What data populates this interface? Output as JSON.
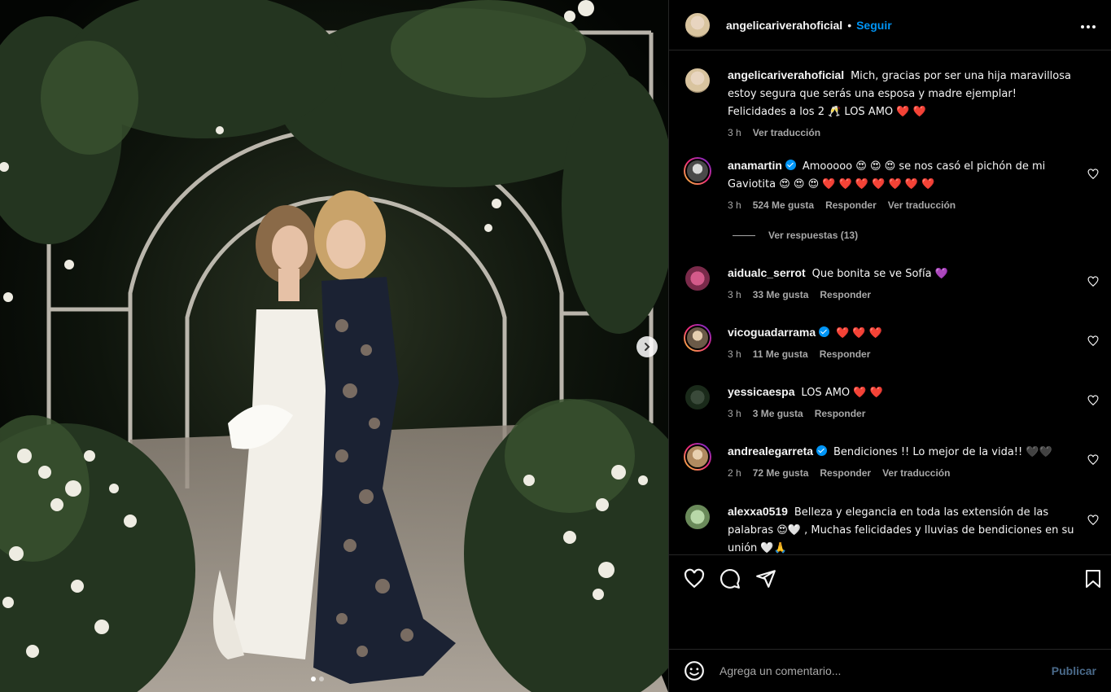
{
  "post": {
    "author": "angelicariverahoficial",
    "separator": "•",
    "follow_label": "Seguir",
    "more_label": "•••",
    "carousel_next": "›"
  },
  "caption": {
    "username": "angelicariverahoficial",
    "text": "Mich, gracias por ser una hija maravillosa estoy segura que serás una esposa y madre ejemplar! Felicidades a los 2 🥂 LOS AMO ❤️ ❤️",
    "time": "3 h",
    "translate": "Ver traducción"
  },
  "comments": [
    {
      "username": "anamartin",
      "verified": true,
      "text": "Amooooo 😍 😍 😍 se nos casó el pichón de mi Gaviotita 😍 😍 😍 ❤️ ❤️ ❤️ ❤️ ❤️ ❤️ ❤️",
      "time": "3 h",
      "likes": "524 Me gusta",
      "reply": "Responder",
      "translate": "Ver traducción"
    },
    {
      "username": "aidualc_serrot",
      "verified": false,
      "text": "Que bonita se ve Sofía 💜",
      "time": "3 h",
      "likes": "33 Me gusta",
      "reply": "Responder"
    },
    {
      "username": "vicoguadarrama",
      "verified": true,
      "text": "❤️ ❤️ ❤️",
      "time": "3 h",
      "likes": "11 Me gusta",
      "reply": "Responder"
    },
    {
      "username": "yessicaespa",
      "verified": false,
      "text": "LOS AMO ❤️ ❤️",
      "time": "3 h",
      "likes": "3 Me gusta",
      "reply": "Responder"
    },
    {
      "username": "andrealegarreta",
      "verified": true,
      "text": "Bendiciones !! Lo mejor de la vida!! 🖤🖤",
      "time": "2 h",
      "likes": "72 Me gusta",
      "reply": "Responder",
      "translate": "Ver traducción"
    },
    {
      "username": "alexxa0519",
      "verified": false,
      "text": "Belleza y elegancia en toda las extensión de las palabras 😍🤍 , Muchas felicidades y lluvias de bendiciones en su unión 🤍🙏"
    }
  ],
  "replies_toggle": "Ver respuestas (13)",
  "add_comment": {
    "placeholder": "Agrega un comentario...",
    "publish": "Publicar"
  },
  "icons": [
    "heart-icon",
    "comment-icon",
    "share-icon",
    "bookmark-icon",
    "emoji-icon",
    "chevron-right-icon",
    "more-options-icon"
  ],
  "colors": {
    "accent": "#0095f6",
    "muted": "#a8a8a8",
    "background": "#000000",
    "divider": "#262626"
  }
}
